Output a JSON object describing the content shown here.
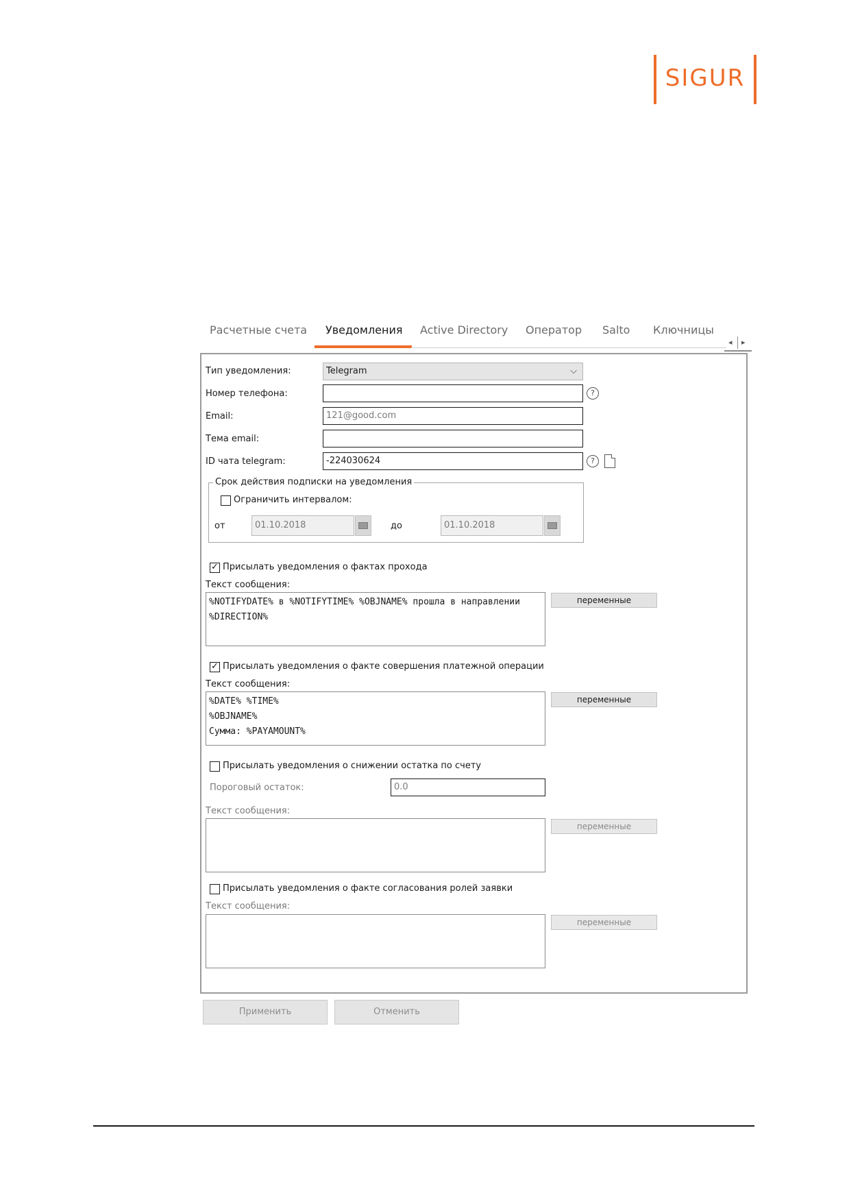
{
  "logo": {
    "text": "SIGUR",
    "brand_color": "#ee6d2a"
  },
  "tabs": [
    {
      "label": "Расчетные счета",
      "active": false
    },
    {
      "label": "Уведомления",
      "active": true
    },
    {
      "label": "Active Directory",
      "active": false
    },
    {
      "label": "Оператор",
      "active": false
    },
    {
      "label": "Salto",
      "active": false
    },
    {
      "label": "Ключницы",
      "active": false
    }
  ],
  "form": {
    "notify_type": {
      "label": "Тип уведомления:",
      "value": "Telegram"
    },
    "phone": {
      "label": "Номер телефона:",
      "value": ""
    },
    "email": {
      "label": "Email:",
      "value": "121@good.com"
    },
    "email_subject": {
      "label": "Тема email:",
      "value": ""
    },
    "telegram_id": {
      "label": "ID чата telegram:",
      "value": "-224030624"
    }
  },
  "subscription": {
    "legend": "Срок действия подписки на уведомления",
    "limit_label": "Ограничить интервалом:",
    "limit_checked": false,
    "from_label": "от",
    "from_value": "01.10.2018",
    "to_label": "до",
    "to_value": "01.10.2018"
  },
  "sections": {
    "pass": {
      "checkbox_label": "Присылать уведомления о фактах прохода",
      "checked": true,
      "text_label": "Текст сообщения:",
      "text": "%NOTIFYDATE% в %NOTIFYTIME% %OBJNAME% прошла в направлении %DIRECTION%",
      "vars_button": "переменные"
    },
    "payment": {
      "checkbox_label": "Присылать уведомления о факте совершения платежной операции",
      "checked": true,
      "text_label": "Текст сообщения:",
      "text": "%DATE% %TIME%\n%OBJNAME%\nСумма: %PAYAMOUNT%",
      "vars_button": "переменные"
    },
    "balance": {
      "checkbox_label": "Присылать уведомления о снижении остатка по счету",
      "checked": false,
      "threshold_label": "Пороговый остаток:",
      "threshold_value": "0.0",
      "text_label": "Текст сообщения:",
      "text": "",
      "vars_button": "переменные"
    },
    "roles": {
      "checkbox_label": "Присылать уведомления о факте согласования ролей заявки",
      "checked": false,
      "text_label": "Текст сообщения:",
      "text": "",
      "vars_button": "переменные"
    }
  },
  "buttons": {
    "apply": "Применить",
    "cancel": "Отменить"
  }
}
